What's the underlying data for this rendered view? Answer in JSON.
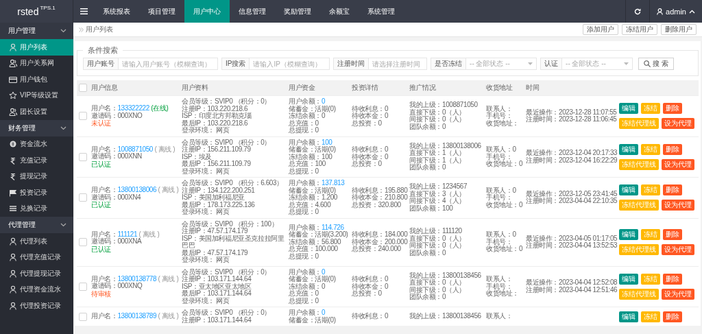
{
  "topbar": {
    "logo": "rsted",
    "version": "TPS.1",
    "nav": [
      {
        "label": "系统报表",
        "selected": false
      },
      {
        "label": "项目管理",
        "selected": false
      },
      {
        "label": "用户中心",
        "selected": true
      },
      {
        "label": "信息管理",
        "selected": false
      },
      {
        "label": "奖励管理",
        "selected": false
      },
      {
        "label": "余额宝",
        "selected": false
      },
      {
        "label": "系统管理",
        "selected": false
      }
    ],
    "user": "admin"
  },
  "sidebar": {
    "groups": [
      {
        "label": "用户管理",
        "expanded": true,
        "items": [
          {
            "label": "用户列表",
            "kind": "person",
            "selected": true
          },
          {
            "label": "用户关系网",
            "kind": "people",
            "selected": false
          },
          {
            "label": "用户钱包",
            "kind": "card",
            "selected": false
          },
          {
            "label": "VIP等级设置",
            "kind": "star",
            "selected": false
          },
          {
            "label": "团长设置",
            "kind": "people",
            "selected": false
          }
        ]
      },
      {
        "label": "财务管理",
        "expanded": true,
        "items": [
          {
            "label": "资金流水",
            "kind": "coin",
            "selected": false
          },
          {
            "label": "充值记录",
            "kind": "rupee",
            "selected": false
          },
          {
            "label": "提现记录",
            "kind": "rupee",
            "selected": false
          },
          {
            "label": "投资记录",
            "kind": "flag",
            "selected": false
          },
          {
            "label": "兑换记录",
            "kind": "lines",
            "selected": false
          }
        ]
      },
      {
        "label": "代理管理",
        "expanded": true,
        "items": [
          {
            "label": "代理列表",
            "kind": "person",
            "selected": false
          },
          {
            "label": "代理充值记录",
            "kind": "person",
            "selected": false
          },
          {
            "label": "代理提现记录",
            "kind": "person",
            "selected": false
          },
          {
            "label": "代理资金流水",
            "kind": "person",
            "selected": false
          },
          {
            "label": "代理投资记录",
            "kind": "person",
            "selected": false
          }
        ]
      }
    ]
  },
  "breadcrumb": "用户列表",
  "header_buttons": [
    "添加用户",
    "冻结用户",
    "删除用户"
  ],
  "search": {
    "legend": "条件搜索",
    "fields": [
      {
        "kind": "text",
        "label": "用户账号",
        "placeholder": "请输入用户账号（模糊查询）"
      },
      {
        "kind": "text",
        "label": "IP搜索",
        "placeholder": "请输入IP（模糊查询）"
      },
      {
        "kind": "text",
        "label": "注册时间",
        "placeholder": "请选择注册时间"
      },
      {
        "kind": "select",
        "label": "是否冻结",
        "value": "-- 全部状态 --"
      },
      {
        "kind": "select",
        "label": "认证",
        "value": "-- 全部状态 --"
      }
    ],
    "button": "搜 索"
  },
  "table": {
    "all_selected": false,
    "columns": [
      "用户信息",
      "用户资料",
      "用户资金",
      "投资详情",
      "推广情况",
      "收货地址",
      "时间"
    ],
    "rows": [
      {
        "selected": false,
        "info": {
          "username_label": "用户名：",
          "username": "133322222",
          "online": {
            "text": "(在线)",
            "kind": "online"
          },
          "invite": "邀请码：000XNO",
          "auth": {
            "text": "未认证",
            "kind": "unverified"
          }
        },
        "profile": [
          "会员等级：SVIP0 （积分：0）",
          "注册IP：103.220.218.6",
          "ISP：印度北方邦勒克瑙",
          "最后IP：103.220.218.6",
          "登录环境： 网页"
        ],
        "funds": {
          "balance_label": "用户余额：",
          "balance": "0",
          "lines": [
            "储蓄金：活期(0)",
            "冻结余额：0",
            "总充值：0",
            "总提现：0"
          ]
        },
        "invest": [
          "待收利息：0",
          "待收本金：0",
          "总投资：0"
        ],
        "promo": [
          "我的上级：1008871050",
          "直接下级：0（人）",
          "间接下级：0（人）",
          "团队余额：0"
        ],
        "address": [
          "联系人：",
          "手机号：",
          "收货地址："
        ],
        "times": [
          "最近操作：2023-12-28 11:07:55",
          "注册时间：2023-12-28 11:06:45"
        ],
        "actions": [
          [
            {
              "label": "编辑",
              "kind": "main"
            },
            {
              "label": "冻结",
              "kind": "warn"
            },
            {
              "label": "删除",
              "kind": "danger"
            }
          ],
          [
            {
              "label": "冻结代理线",
              "kind": "warn"
            },
            {
              "label": "设为代理",
              "kind": "danger"
            }
          ]
        ]
      },
      {
        "selected": false,
        "info": {
          "username_label": "用户名：",
          "username": "1008871050",
          "online": {
            "text": "( 离线 )",
            "kind": "offline"
          },
          "invite": "邀请码：000XNN",
          "auth": {
            "text": "已认证",
            "kind": "verified"
          }
        },
        "profile": [
          "会员等级：SVIP0 （积分：0）",
          "注册IP：156.211.109.79",
          "ISP：埃及",
          "最后IP：156.211.109.79",
          "登录环境： 网页"
        ],
        "funds": {
          "balance_label": "用户余额：",
          "balance": "100",
          "lines": [
            "储蓄金：活期(0)",
            "冻结余额：100",
            "总充值：100",
            "总提现：0"
          ]
        },
        "invest": [
          "待收利息：0",
          "待收本金：0",
          "总投资：0"
        ],
        "promo": [
          "我的上级：13800138006",
          "直接下级：1（人）",
          "间接下级：1（人）",
          "团队余额：0"
        ],
        "address": [
          "联系人：0",
          "手机号：",
          "收货地址：0"
        ],
        "times": [
          "最近操作：2023-12-04 20:17:33",
          "注册时间：2023-12-04 16:22:29"
        ],
        "actions": [
          [
            {
              "label": "编辑",
              "kind": "main"
            },
            {
              "label": "冻结",
              "kind": "warn"
            },
            {
              "label": "删除",
              "kind": "danger"
            }
          ],
          [
            {
              "label": "冻结代理线",
              "kind": "warn"
            },
            {
              "label": "设为代理",
              "kind": "danger"
            }
          ]
        ]
      },
      {
        "selected": false,
        "info": {
          "username_label": "用户名：",
          "username": "13800138006",
          "online": {
            "text": "( 离线 )",
            "kind": "offline"
          },
          "invite": "邀请码：000XN4",
          "auth": {
            "text": "已认证",
            "kind": "verified"
          }
        },
        "profile": [
          "会员等级：SVIP0 （积分：6.603）",
          "注册IP：134.122.200.251",
          "ISP：美国加利福尼亚",
          "最后IP：178.173.225.136",
          "登录环境： 网页"
        ],
        "funds": {
          "balance_label": "用户余额：",
          "balance": "137.813",
          "lines": [
            "储蓄金：活期(0)",
            "冻结余额：1.200",
            "总充值：4.600",
            "总提现：0"
          ]
        },
        "invest": [
          "待收利息：195.880",
          "待收本金：210.800",
          "总投资：320.800"
        ],
        "promo": [
          "我的上级：1234567",
          "直接下级：3（人）",
          "间接下级：4（人）",
          "团队余额：100"
        ],
        "address": [
          "联系人：0",
          "手机号：",
          "收货地址：0"
        ],
        "times": [
          "最近操作：2023-12-05 23:41:45",
          "注册时间：2023-04-04 22:10:35"
        ],
        "actions": [
          [
            {
              "label": "编辑",
              "kind": "main"
            },
            {
              "label": "冻结",
              "kind": "warn"
            },
            {
              "label": "删除",
              "kind": "danger"
            }
          ],
          [
            {
              "label": "冻结代理线",
              "kind": "warn"
            },
            {
              "label": "设为代理",
              "kind": "danger"
            }
          ]
        ]
      },
      {
        "selected": false,
        "info": {
          "username_label": "用户名：",
          "username": "111121",
          "online": {
            "text": "( 离线 )",
            "kind": "offline"
          },
          "invite": "邀请码：000XNA",
          "auth": {
            "text": "已认证",
            "kind": "verified"
          }
        },
        "profile": [
          "会员等级：SVIP0 （积分：100）",
          "注册IP：47.57.174.179",
          "ISP：美国加利福尼亚圣克拉拉阿里巴巴",
          "最后IP：47.57.174.179",
          "登录环境： 网页"
        ],
        "funds": {
          "balance_label": "用户余额：",
          "balance": "114.726",
          "lines": [
            "储蓄金：活期(3.200)",
            "冻结余额：56.800",
            "总充值：100.000",
            "总提现：0"
          ]
        },
        "invest": [
          "待收利息：184.000",
          "待收本金：200.000",
          "总投资：240.000"
        ],
        "promo": [
          "我的上级：111120",
          "直接下级：0（人）",
          "间接下级：0（人）",
          "团队余额：0"
        ],
        "address": [
          "联系人：0",
          "手机号：",
          "收货地址：0"
        ],
        "times": [
          "最近操作：2023-04-05 01:17:05",
          "注册时间：2023-04-04 13:52:53"
        ],
        "actions": [
          [
            {
              "label": "编辑",
              "kind": "main"
            },
            {
              "label": "冻结",
              "kind": "warn"
            },
            {
              "label": "删除",
              "kind": "danger"
            }
          ],
          [
            {
              "label": "冻结代理线",
              "kind": "warn"
            },
            {
              "label": "设为代理",
              "kind": "danger"
            }
          ]
        ]
      },
      {
        "selected": false,
        "info": {
          "username_label": "用户名：",
          "username": "13800138778",
          "online": {
            "text": "( 离线 )",
            "kind": "offline"
          },
          "invite": "邀请码：000XNQ",
          "auth": {
            "text": "待审核",
            "kind": "pending"
          }
        },
        "profile": [
          "会员等级：SVIP0 （积分：0）",
          "注册IP：103.171.144.64",
          "ISP：亚太地区亚太地区",
          "最后IP：103.171.144.64",
          "登录环境： 网页"
        ],
        "funds": {
          "balance_label": "用户余额：",
          "balance": "0",
          "lines": [
            "储蓄金：活期(0)",
            "冻结余额：0",
            "总充值：0",
            "总提现：0"
          ]
        },
        "invest": [
          "待收利息：0",
          "待收本金：0",
          "总投资：0"
        ],
        "promo": [
          "我的上级：13800138456",
          "直接下级：0（人）",
          "间接下级：0（人）",
          "团队余额：0"
        ],
        "address": [
          "联系人：",
          "手机号：",
          "收货地址："
        ],
        "times": [
          "最近操作：2023-04-04 12:52:08",
          "注册时间：2023-04-04 12:51:46"
        ],
        "actions": [
          [
            {
              "label": "编辑",
              "kind": "main"
            },
            {
              "label": "冻结",
              "kind": "warn"
            },
            {
              "label": "删除",
              "kind": "danger"
            }
          ],
          [
            {
              "label": "冻结代理线",
              "kind": "warn"
            },
            {
              "label": "设为代理",
              "kind": "danger"
            }
          ]
        ]
      },
      {
        "selected": false,
        "info": {
          "username_label": "用户名：",
          "username": "13800138789",
          "online": {
            "text": "( 离线 )",
            "kind": "offline"
          }
        },
        "profile": [
          "会员等级：SVIP0 （积分：0）",
          "注册IP：103.171.144.64"
        ],
        "funds": {
          "balance_label": "用户余额：",
          "balance": "0",
          "lines": [
            "储蓄金：活期(0)"
          ]
        },
        "invest": [
          "待收利息：0"
        ],
        "promo": [
          "我的上级：13800138456"
        ],
        "address": [
          "联系人："
        ],
        "times": [],
        "actions": [
          [
            {
              "label": "编辑",
              "kind": "main"
            },
            {
              "label": "冻结",
              "kind": "warn"
            },
            {
              "label": "删除",
              "kind": "danger"
            }
          ]
        ]
      }
    ]
  }
}
